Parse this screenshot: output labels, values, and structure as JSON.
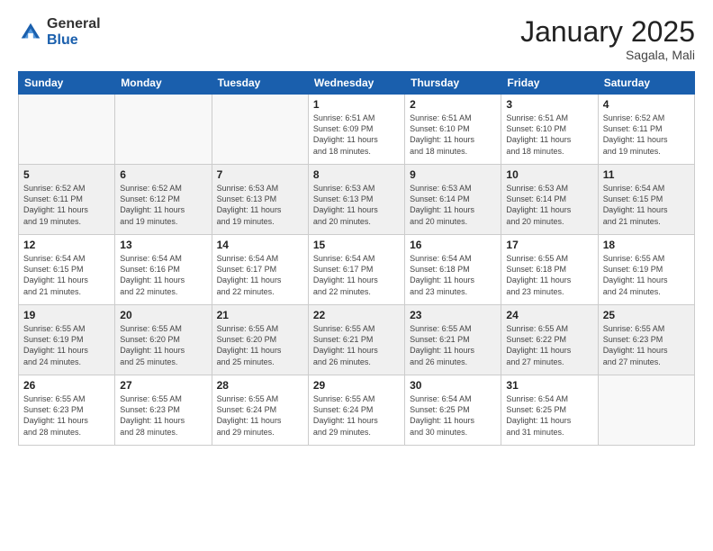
{
  "logo": {
    "general": "General",
    "blue": "Blue"
  },
  "header": {
    "month": "January 2025",
    "location": "Sagala, Mali"
  },
  "weekdays": [
    "Sunday",
    "Monday",
    "Tuesday",
    "Wednesday",
    "Thursday",
    "Friday",
    "Saturday"
  ],
  "weeks": [
    [
      {
        "day": "",
        "info": ""
      },
      {
        "day": "",
        "info": ""
      },
      {
        "day": "",
        "info": ""
      },
      {
        "day": "1",
        "info": "Sunrise: 6:51 AM\nSunset: 6:09 PM\nDaylight: 11 hours\nand 18 minutes."
      },
      {
        "day": "2",
        "info": "Sunrise: 6:51 AM\nSunset: 6:10 PM\nDaylight: 11 hours\nand 18 minutes."
      },
      {
        "day": "3",
        "info": "Sunrise: 6:51 AM\nSunset: 6:10 PM\nDaylight: 11 hours\nand 18 minutes."
      },
      {
        "day": "4",
        "info": "Sunrise: 6:52 AM\nSunset: 6:11 PM\nDaylight: 11 hours\nand 19 minutes."
      }
    ],
    [
      {
        "day": "5",
        "info": "Sunrise: 6:52 AM\nSunset: 6:11 PM\nDaylight: 11 hours\nand 19 minutes."
      },
      {
        "day": "6",
        "info": "Sunrise: 6:52 AM\nSunset: 6:12 PM\nDaylight: 11 hours\nand 19 minutes."
      },
      {
        "day": "7",
        "info": "Sunrise: 6:53 AM\nSunset: 6:13 PM\nDaylight: 11 hours\nand 19 minutes."
      },
      {
        "day": "8",
        "info": "Sunrise: 6:53 AM\nSunset: 6:13 PM\nDaylight: 11 hours\nand 20 minutes."
      },
      {
        "day": "9",
        "info": "Sunrise: 6:53 AM\nSunset: 6:14 PM\nDaylight: 11 hours\nand 20 minutes."
      },
      {
        "day": "10",
        "info": "Sunrise: 6:53 AM\nSunset: 6:14 PM\nDaylight: 11 hours\nand 20 minutes."
      },
      {
        "day": "11",
        "info": "Sunrise: 6:54 AM\nSunset: 6:15 PM\nDaylight: 11 hours\nand 21 minutes."
      }
    ],
    [
      {
        "day": "12",
        "info": "Sunrise: 6:54 AM\nSunset: 6:15 PM\nDaylight: 11 hours\nand 21 minutes."
      },
      {
        "day": "13",
        "info": "Sunrise: 6:54 AM\nSunset: 6:16 PM\nDaylight: 11 hours\nand 22 minutes."
      },
      {
        "day": "14",
        "info": "Sunrise: 6:54 AM\nSunset: 6:17 PM\nDaylight: 11 hours\nand 22 minutes."
      },
      {
        "day": "15",
        "info": "Sunrise: 6:54 AM\nSunset: 6:17 PM\nDaylight: 11 hours\nand 22 minutes."
      },
      {
        "day": "16",
        "info": "Sunrise: 6:54 AM\nSunset: 6:18 PM\nDaylight: 11 hours\nand 23 minutes."
      },
      {
        "day": "17",
        "info": "Sunrise: 6:55 AM\nSunset: 6:18 PM\nDaylight: 11 hours\nand 23 minutes."
      },
      {
        "day": "18",
        "info": "Sunrise: 6:55 AM\nSunset: 6:19 PM\nDaylight: 11 hours\nand 24 minutes."
      }
    ],
    [
      {
        "day": "19",
        "info": "Sunrise: 6:55 AM\nSunset: 6:19 PM\nDaylight: 11 hours\nand 24 minutes."
      },
      {
        "day": "20",
        "info": "Sunrise: 6:55 AM\nSunset: 6:20 PM\nDaylight: 11 hours\nand 25 minutes."
      },
      {
        "day": "21",
        "info": "Sunrise: 6:55 AM\nSunset: 6:20 PM\nDaylight: 11 hours\nand 25 minutes."
      },
      {
        "day": "22",
        "info": "Sunrise: 6:55 AM\nSunset: 6:21 PM\nDaylight: 11 hours\nand 26 minutes."
      },
      {
        "day": "23",
        "info": "Sunrise: 6:55 AM\nSunset: 6:21 PM\nDaylight: 11 hours\nand 26 minutes."
      },
      {
        "day": "24",
        "info": "Sunrise: 6:55 AM\nSunset: 6:22 PM\nDaylight: 11 hours\nand 27 minutes."
      },
      {
        "day": "25",
        "info": "Sunrise: 6:55 AM\nSunset: 6:23 PM\nDaylight: 11 hours\nand 27 minutes."
      }
    ],
    [
      {
        "day": "26",
        "info": "Sunrise: 6:55 AM\nSunset: 6:23 PM\nDaylight: 11 hours\nand 28 minutes."
      },
      {
        "day": "27",
        "info": "Sunrise: 6:55 AM\nSunset: 6:23 PM\nDaylight: 11 hours\nand 28 minutes."
      },
      {
        "day": "28",
        "info": "Sunrise: 6:55 AM\nSunset: 6:24 PM\nDaylight: 11 hours\nand 29 minutes."
      },
      {
        "day": "29",
        "info": "Sunrise: 6:55 AM\nSunset: 6:24 PM\nDaylight: 11 hours\nand 29 minutes."
      },
      {
        "day": "30",
        "info": "Sunrise: 6:54 AM\nSunset: 6:25 PM\nDaylight: 11 hours\nand 30 minutes."
      },
      {
        "day": "31",
        "info": "Sunrise: 6:54 AM\nSunset: 6:25 PM\nDaylight: 11 hours\nand 31 minutes."
      },
      {
        "day": "",
        "info": ""
      }
    ]
  ]
}
